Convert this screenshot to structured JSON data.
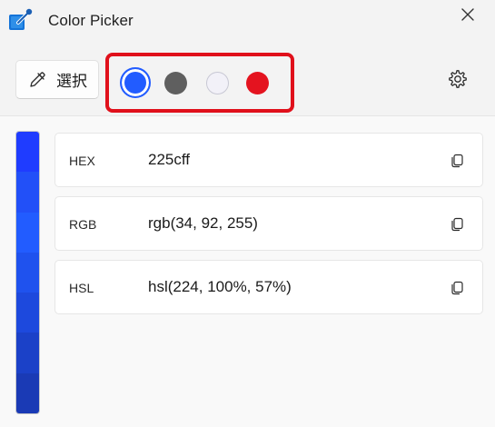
{
  "window": {
    "title": "Color Picker",
    "app_icon": "color-picker-icon",
    "close_icon": "close-icon"
  },
  "toolbar": {
    "pick_button_label": "選択",
    "pick_button_icon": "eyedropper-icon",
    "settings_icon": "gear-icon",
    "highlight_color": "#e0101b",
    "swatches": [
      {
        "color": "#225cff",
        "selected": true
      },
      {
        "color": "#5f5f5f",
        "selected": false
      },
      {
        "color": "#f2f1f8",
        "selected": false
      },
      {
        "color": "#e4131f",
        "selected": false
      }
    ]
  },
  "color_bar": {
    "shades": [
      "#1f3cff",
      "#2250f8",
      "#225cff",
      "#1f52ee",
      "#1d49dd",
      "#1b41c8",
      "#1a3ab5"
    ]
  },
  "formats": [
    {
      "name": "HEX",
      "value": "225cff",
      "copy_icon": "copy-icon"
    },
    {
      "name": "RGB",
      "value": "rgb(34, 92, 255)",
      "copy_icon": "copy-icon"
    },
    {
      "name": "HSL",
      "value": "hsl(224, 100%, 57%)",
      "copy_icon": "copy-icon"
    }
  ]
}
